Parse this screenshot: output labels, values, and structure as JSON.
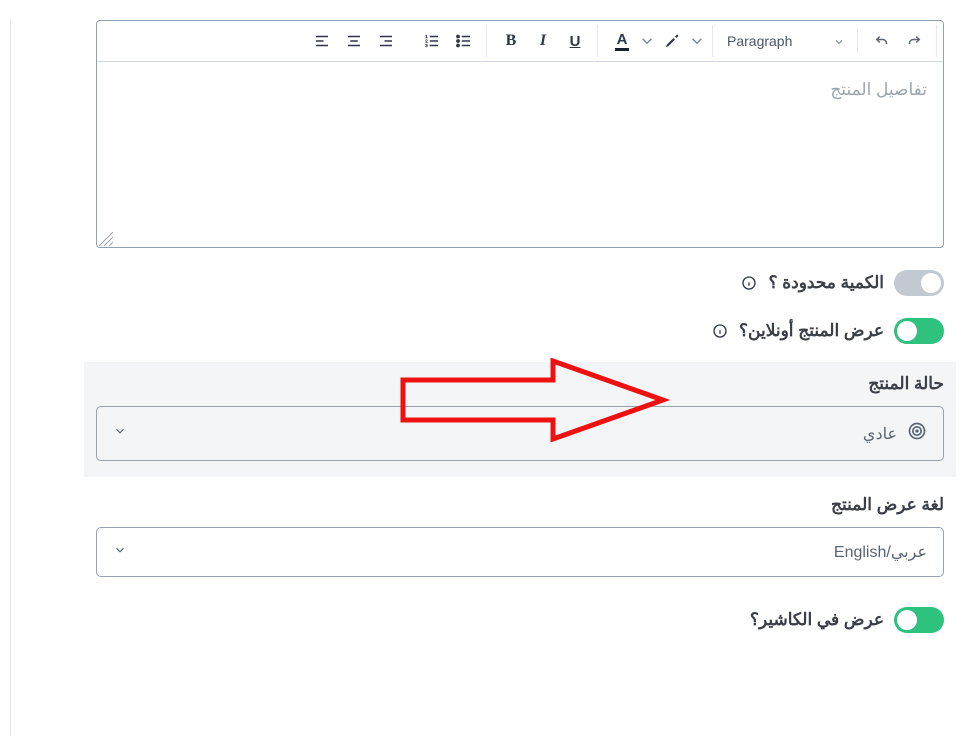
{
  "editor": {
    "style_selector": "Paragraph",
    "placeholder": "تفاصيل المنتج"
  },
  "toggles": {
    "limited_qty": {
      "label": "الكمية محدودة ؟",
      "on": false
    },
    "show_online": {
      "label": "عرض المنتج أونلاين؟",
      "on": true
    },
    "show_cashier": {
      "label": "عرض في الكاشير؟",
      "on": true
    }
  },
  "product_status": {
    "title": "حالة المنتج",
    "value": "عادي"
  },
  "product_language": {
    "title": "لغة عرض المنتج",
    "value": "عربي/English"
  }
}
